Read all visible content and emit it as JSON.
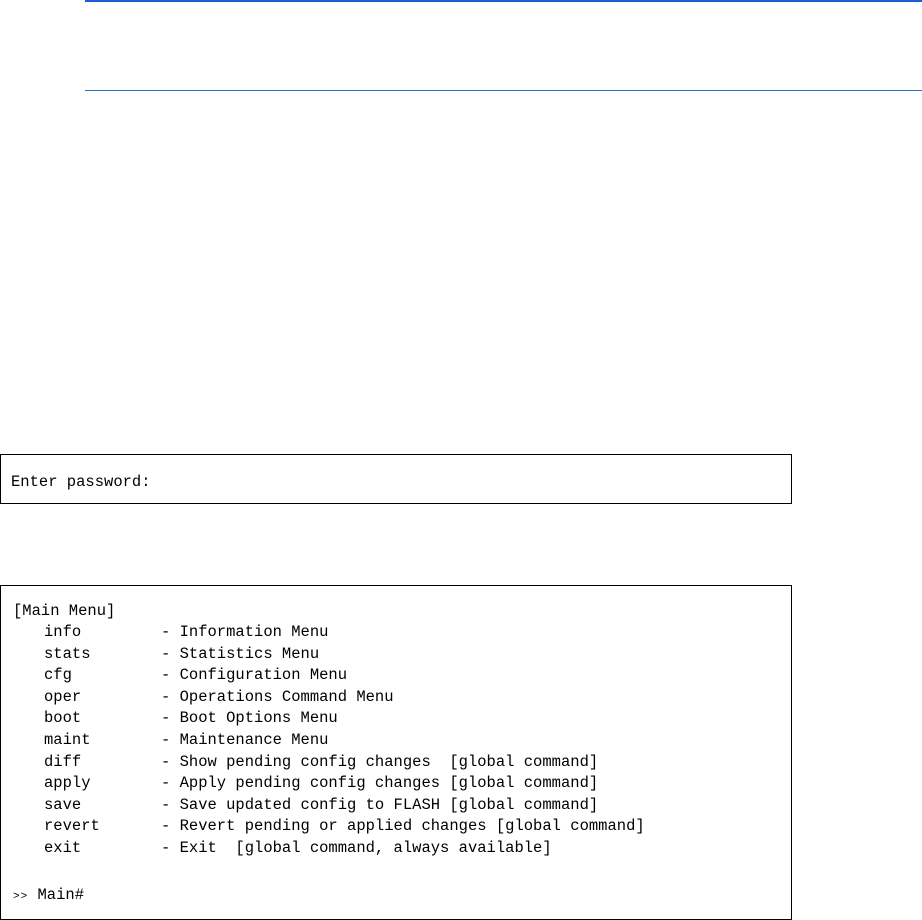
{
  "password_box": {
    "prompt": "Enter password:"
  },
  "menu_box": {
    "header": "[Main Menu]",
    "items": [
      {
        "command": "info",
        "description": "- Information Menu"
      },
      {
        "command": "stats",
        "description": "- Statistics Menu"
      },
      {
        "command": "cfg",
        "description": "- Configuration Menu"
      },
      {
        "command": "oper",
        "description": "- Operations Command Menu"
      },
      {
        "command": "boot",
        "description": "- Boot Options Menu"
      },
      {
        "command": "maint",
        "description": "- Maintenance Menu"
      },
      {
        "command": "diff",
        "description": "- Show pending config changes  [global command]"
      },
      {
        "command": "apply",
        "description": "- Apply pending config changes [global command]"
      },
      {
        "command": "save",
        "description": "- Save updated config to FLASH [global command]"
      },
      {
        "command": "revert",
        "description": "- Revert pending or applied changes [global command]"
      },
      {
        "command": "exit",
        "description": "- Exit  [global command, always available]"
      }
    ],
    "prompt_symbol": ">>",
    "prompt_text": " Main#"
  },
  "colors": {
    "rule_top": "#1a5fd6",
    "rule_bottom": "#2c6fc2"
  }
}
